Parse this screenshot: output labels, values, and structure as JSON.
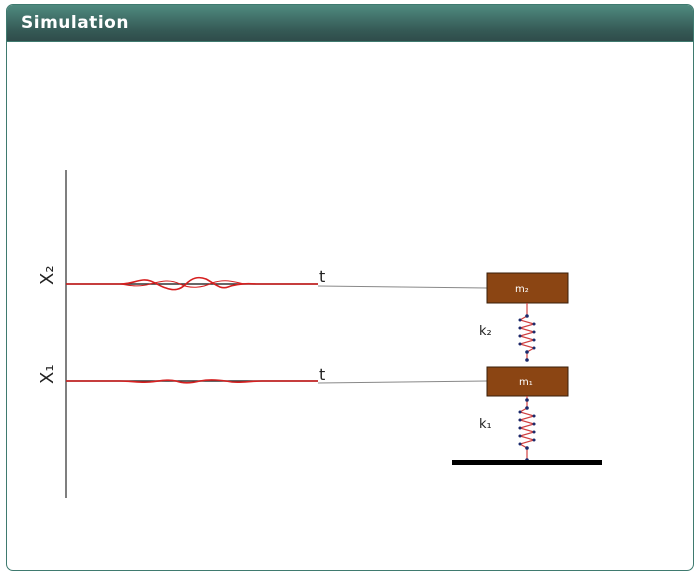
{
  "panel": {
    "title": "Simulation"
  },
  "plot": {
    "x2_label": "X₂",
    "x1_label": "X₁",
    "time_label_top": "t",
    "time_label_bottom": "t",
    "trace_color": "#d62020"
  },
  "system": {
    "mass_top_label": "m₂",
    "mass_bottom_label": "m₁",
    "spring_top_label": "k₂",
    "spring_bottom_label": "k₁",
    "mass_color": "#8b4513",
    "spring_color": "#d04040",
    "spring_node_color": "#1a2a6c",
    "ground_color": "#000000"
  }
}
